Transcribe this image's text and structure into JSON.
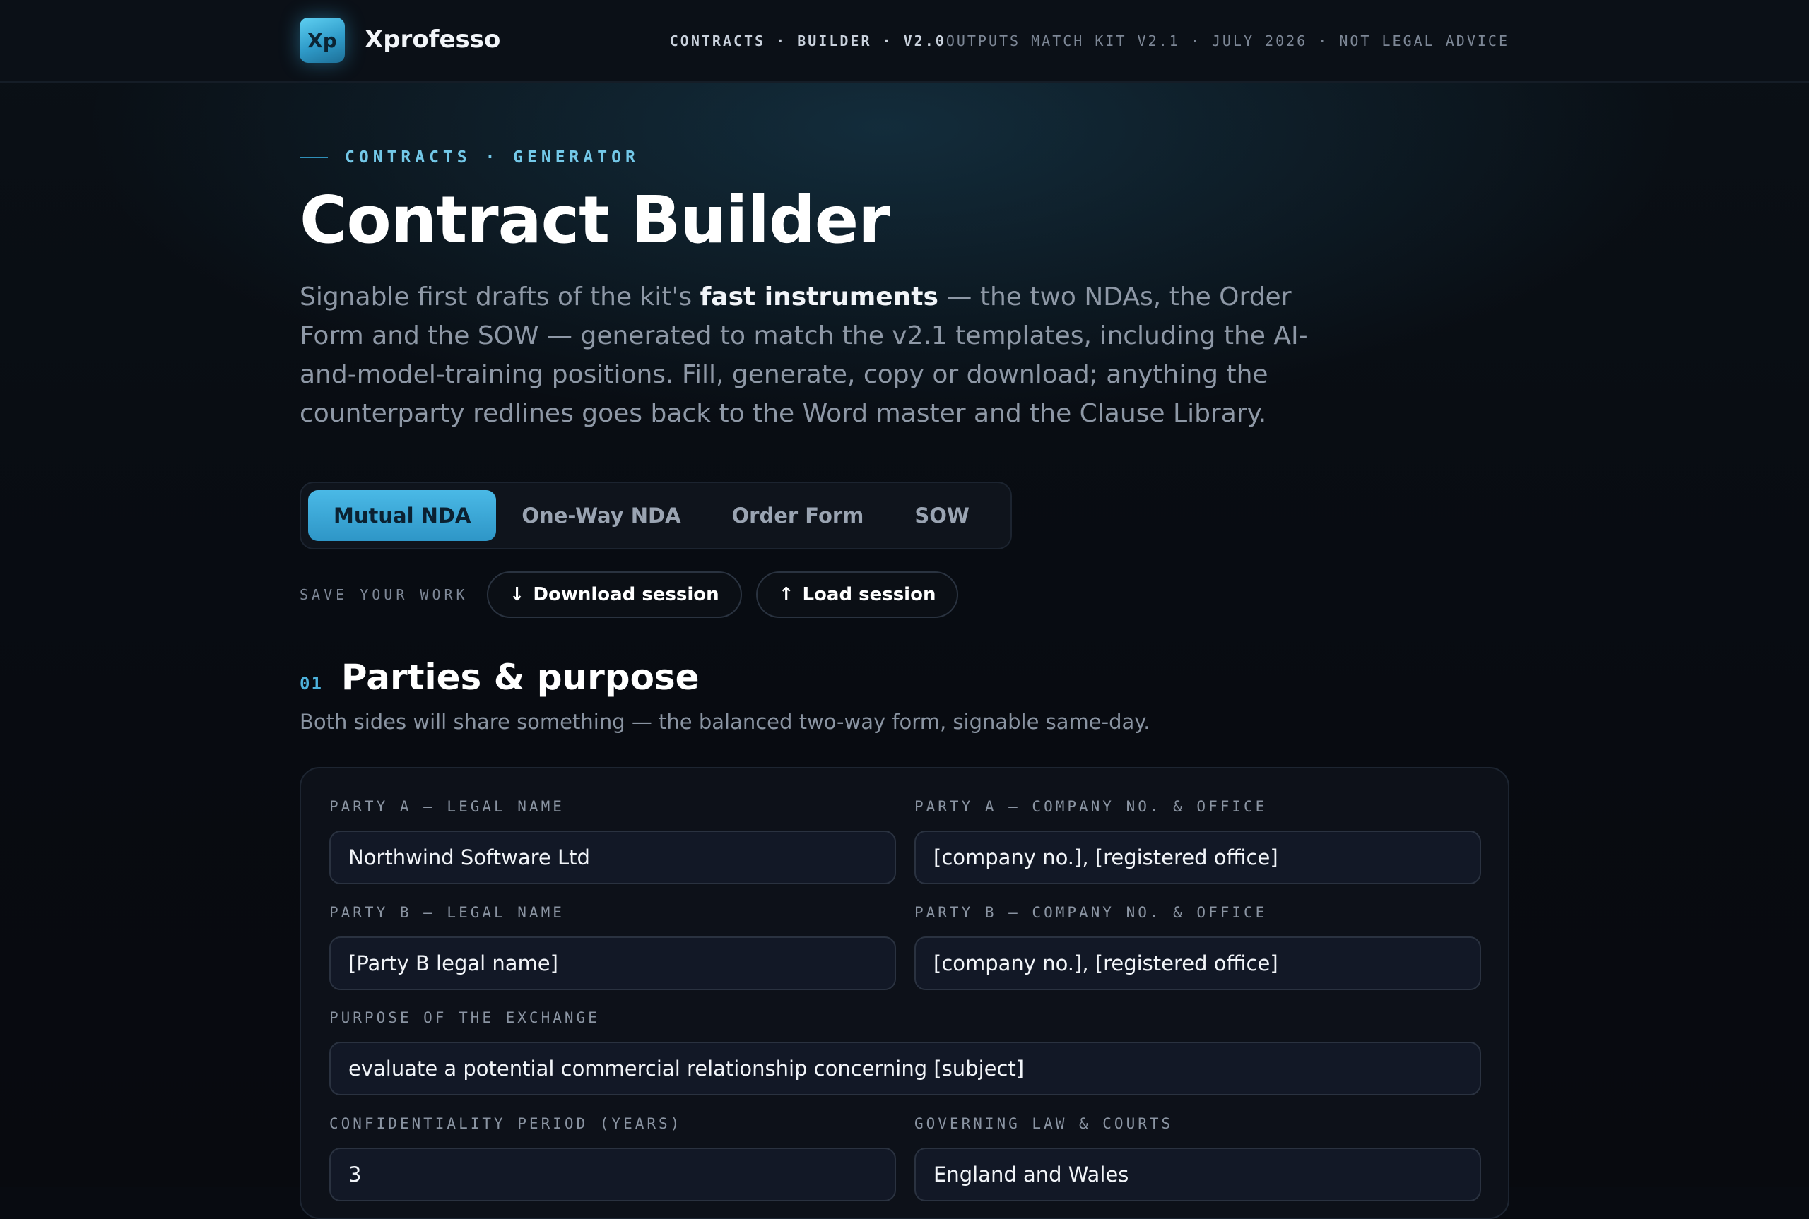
{
  "header": {
    "logo_text": "Xp",
    "brand": "Xprofesso",
    "meta_strong": "CONTRACTS · BUILDER · V2.0",
    "meta_dim": "OUTPUTS MATCH KIT V2.1 · JULY 2026 · NOT LEGAL ADVICE"
  },
  "hero": {
    "eyebrow": "CONTRACTS · GENERATOR",
    "title": "Contract Builder",
    "lede_pre": "Signable first drafts of the kit's ",
    "lede_bold": "fast instruments",
    "lede_post": " — the two NDAs, the Order Form and the SOW — generated to match the v2.1 templates, including the AI-and-model-training positions. Fill, generate, copy or download; anything the counterparty redlines goes back to the Word master and the Clause Library."
  },
  "tabs": [
    {
      "label": "Mutual NDA",
      "active": true
    },
    {
      "label": "One-Way NDA",
      "active": false
    },
    {
      "label": "Order Form",
      "active": false
    },
    {
      "label": "SOW",
      "active": false
    }
  ],
  "session": {
    "label": "SAVE YOUR WORK",
    "download_icon": "↓",
    "download_label": "Download session",
    "load_icon": "↑",
    "load_label": "Load session"
  },
  "section": {
    "number": "01",
    "title": "Parties & purpose",
    "subtitle": "Both sides will share something — the balanced two-way form, signable same-day."
  },
  "form": {
    "party_a_name": {
      "label": "PARTY A — LEGAL NAME",
      "value": "Northwind Software Ltd"
    },
    "party_a_office": {
      "label": "PARTY A — COMPANY NO. & OFFICE",
      "value": "[company no.], [registered office]"
    },
    "party_b_name": {
      "label": "PARTY B — LEGAL NAME",
      "value": "[Party B legal name]"
    },
    "party_b_office": {
      "label": "PARTY B — COMPANY NO. & OFFICE",
      "value": "[company no.], [registered office]"
    },
    "purpose": {
      "label": "PURPOSE OF THE EXCHANGE",
      "value": "evaluate a potential commercial relationship concerning [subject]"
    },
    "period": {
      "label": "CONFIDENTIALITY PERIOD (YEARS)",
      "value": "3"
    },
    "law": {
      "label": "GOVERNING LAW & COURTS",
      "value": "England and Wales"
    }
  }
}
